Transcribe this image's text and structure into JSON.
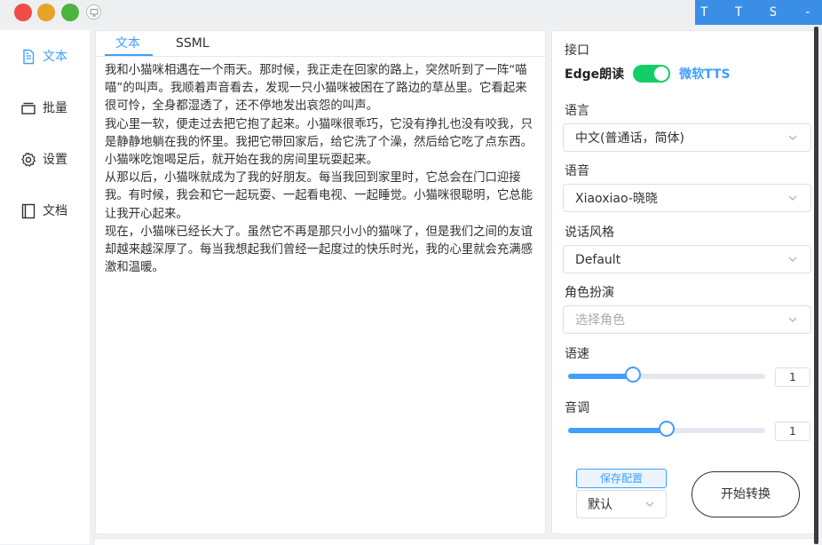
{
  "app": {
    "brand": "T T S - V U E"
  },
  "sidebar": {
    "items": [
      {
        "label": "文本",
        "icon": "document-icon",
        "active": true
      },
      {
        "label": "批量",
        "icon": "stack-icon",
        "active": false
      },
      {
        "label": "设置",
        "icon": "gear-icon",
        "active": false
      },
      {
        "label": "文档",
        "icon": "book-icon",
        "active": false
      }
    ]
  },
  "editor": {
    "tabs": [
      "文本",
      "SSML"
    ],
    "active_tab": "文本",
    "paragraphs": [
      "我和小猫咪相遇在一个雨天。那时候，我正走在回家的路上，突然听到了一阵“喵喵”的叫声。我顺着声音看去，发现一只小猫咪被困在了路边的草丛里。它看起来很可怜，全身都湿透了，还不停地发出哀怨的叫声。",
      "我心里一软，便走过去把它抱了起来。小猫咪很乖巧，它没有挣扎也没有咬我，只是静静地躺在我的怀里。我把它带回家后，给它洗了个澡，然后给它吃了点东西。小猫咪吃饱喝足后，就开始在我的房间里玩耍起来。",
      "从那以后，小猫咪就成为了我的好朋友。每当我回到家里时，它总会在门口迎接我。有时候，我会和它一起玩耍、一起看电视、一起睡觉。小猫咪很聪明，它总能让我开心起来。",
      "现在，小猫咪已经长大了。虽然它不再是那只小小的猫咪了，但是我们之间的友谊却越来越深厚了。每当我想起我们曾经一起度过的快乐时光，我的心里就会充满感激和温暖。"
    ]
  },
  "settings": {
    "api_label": "接口",
    "engine_left": "Edge朗读",
    "engine_right": "微软TTS",
    "engine_toggle_on": true,
    "language_label": "语言",
    "language_value": "中文(普通话，简体)",
    "voice_label": "语音",
    "voice_value": "Xiaoxiao-晓晓",
    "style_label": "说话风格",
    "style_value": "Default",
    "role_label": "角色扮演",
    "role_placeholder": "选择角色",
    "rate_label": "语速",
    "rate_value": "1",
    "rate_fraction": 0.33,
    "pitch_label": "音调",
    "pitch_value": "1",
    "pitch_fraction": 0.5,
    "save_label": "保存配置",
    "preset_value": "默认",
    "start_label": "开始转换"
  },
  "colors": {
    "accent": "#409eff",
    "switch_on": "#13ce66",
    "brand_bg": "#3a8ee6"
  }
}
